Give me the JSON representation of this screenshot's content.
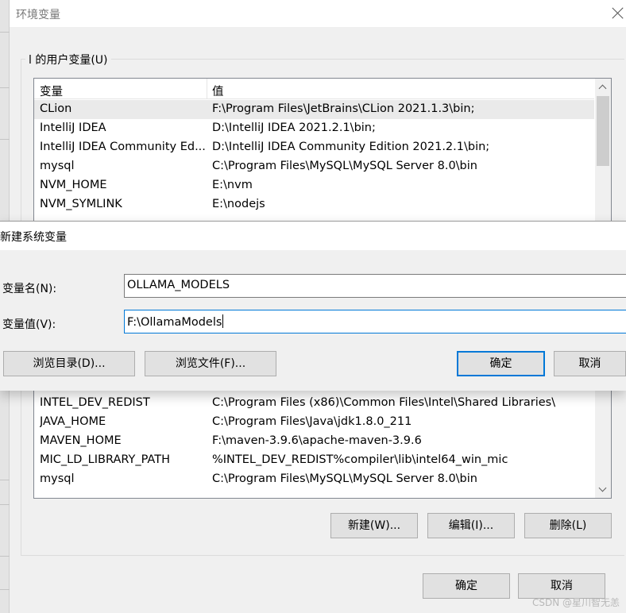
{
  "env_dialog": {
    "title": "环境变量",
    "user_group_label": "l 的用户变量(U)",
    "columns": {
      "name": "变量",
      "value": "值"
    },
    "user_vars": [
      {
        "name": "CLion",
        "value": "F:\\Program Files\\JetBrains\\CLion 2021.1.3\\bin;",
        "selected": true
      },
      {
        "name": "IntelliJ IDEA",
        "value": "D:\\IntelliJ IDEA 2021.2.1\\bin;"
      },
      {
        "name": "IntelliJ IDEA Community Ed...",
        "value": "D:\\IntelliJ IDEA Community Edition 2021.2.1\\bin;"
      },
      {
        "name": "mysql",
        "value": "C:\\Program Files\\MySQL\\MySQL Server 8.0\\bin"
      },
      {
        "name": "NVM_HOME",
        "value": "E:\\nvm"
      },
      {
        "name": "NVM_SYMLINK",
        "value": "E:\\nodejs"
      }
    ],
    "system_vars": [
      {
        "name": "INTEL_DEV_REDIST",
        "value": "C:\\Program Files (x86)\\Common Files\\Intel\\Shared Libraries\\"
      },
      {
        "name": "JAVA_HOME",
        "value": "C:\\Program Files\\Java\\jdk1.8.0_211"
      },
      {
        "name": "MAVEN_HOME",
        "value": "F:\\maven-3.9.6\\apache-maven-3.9.6"
      },
      {
        "name": "MIC_LD_LIBRARY_PATH",
        "value": "%INTEL_DEV_REDIST%compiler\\lib\\intel64_win_mic"
      },
      {
        "name": "mysql",
        "value": "C:\\Program Files\\MySQL\\MySQL Server 8.0\\bin"
      }
    ],
    "system_buttons": {
      "new": "新建(W)...",
      "edit": "编辑(I)...",
      "delete": "删除(L)"
    },
    "ok": "确定",
    "cancel": "取消"
  },
  "new_var_dialog": {
    "title": "新建系统变量",
    "name_label": "变量名(N):",
    "name_value": "OLLAMA_MODELS",
    "value_label": "变量值(V):",
    "value_value": "F:\\OllamaModels",
    "browse_dir": "浏览目录(D)...",
    "browse_file": "浏览文件(F)...",
    "ok": "确定",
    "cancel": "取消"
  },
  "watermark": "CSDN @星川智无恙",
  "colors": {
    "accent": "#0078d7",
    "selection": "#eaeaea"
  },
  "icons": [
    "close-icon",
    "scroll-up-icon",
    "scroll-down-icon"
  ]
}
